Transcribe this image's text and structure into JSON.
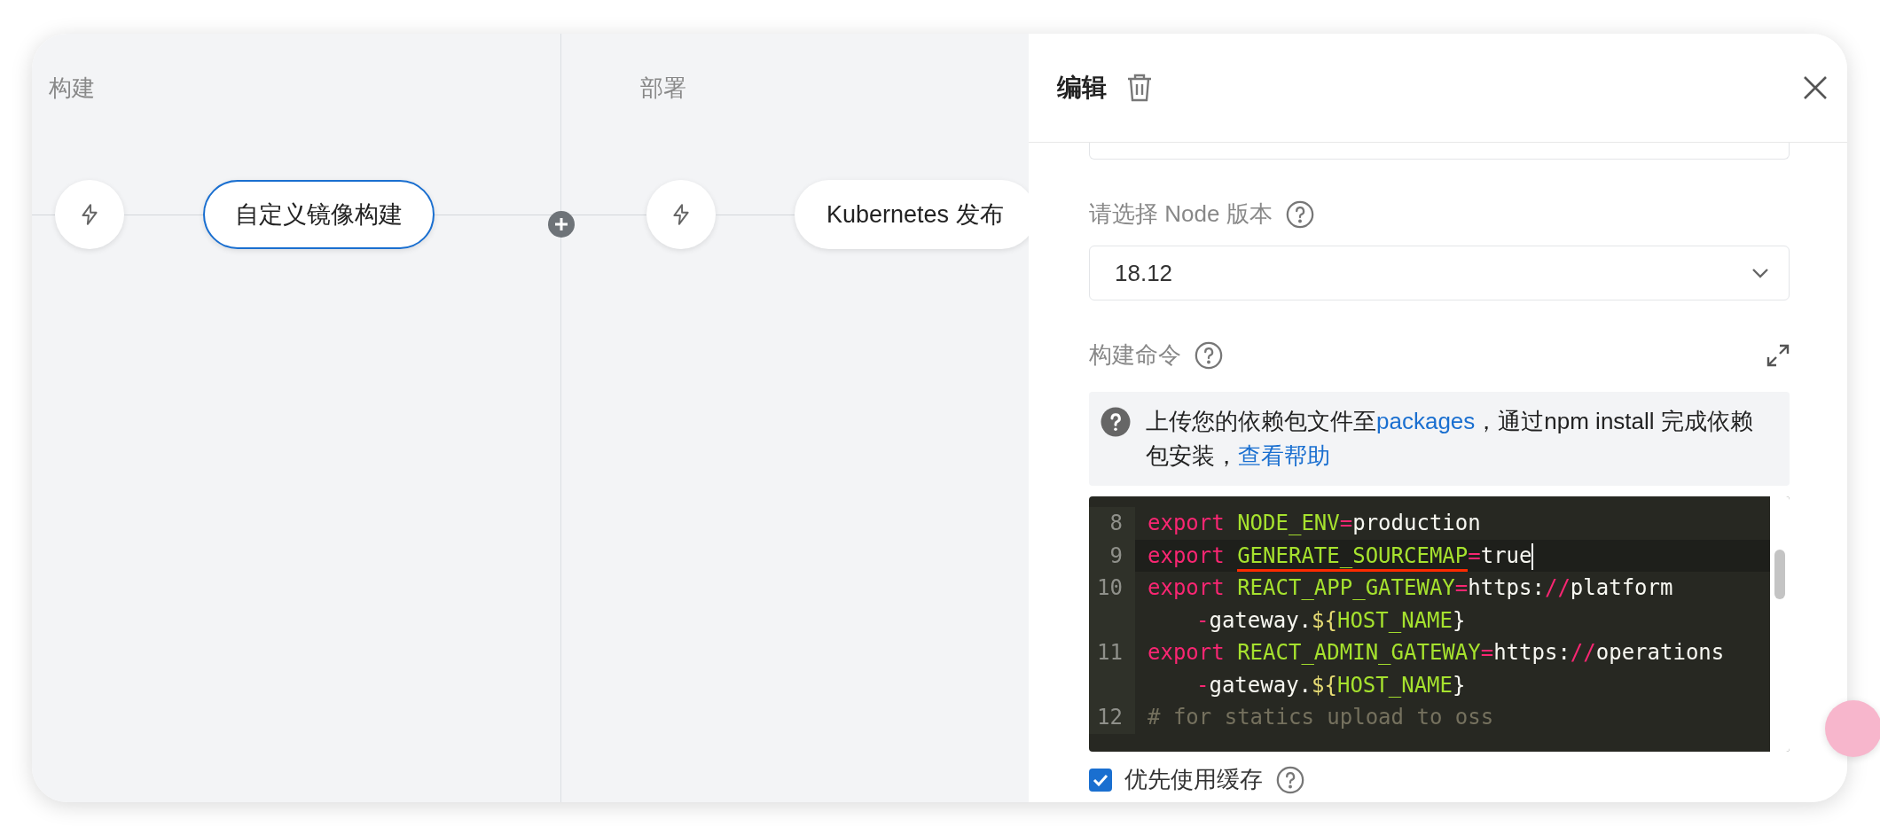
{
  "canvas": {
    "stages": [
      {
        "title": "构建",
        "nodes": [
          {
            "kind": "trigger"
          },
          {
            "kind": "job",
            "label": "自定义镜像构建",
            "selected": true
          }
        ]
      },
      {
        "title": "部署",
        "nodes": [
          {
            "kind": "trigger"
          },
          {
            "kind": "job",
            "label": "Kubernetes 发布",
            "selected": false
          }
        ]
      }
    ]
  },
  "panel": {
    "title": "编辑",
    "node_version": {
      "label": "请选择 Node 版本",
      "value": "18.12"
    },
    "build_command": {
      "label": "构建命令",
      "notice": [
        {
          "text": "上传您的依赖包文件至"
        },
        {
          "text": "packages",
          "link": true
        },
        {
          "text": "，通过npm install 完成依赖包安装，"
        },
        {
          "text": "查看帮助",
          "link": true
        }
      ],
      "code_lines": [
        {
          "number": "8",
          "active": false,
          "tokens": [
            {
              "kind": "keyword",
              "text": "export"
            },
            {
              "kind": "variable",
              "text": "NODE_ENV"
            },
            {
              "kind": "operator",
              "text": "="
            },
            {
              "kind": "text",
              "text": "production"
            }
          ]
        },
        {
          "number": "9",
          "active": true,
          "tokens": [
            {
              "kind": "keyword",
              "text": "export"
            },
            {
              "kind": "variable",
              "text": "GENERATE_SOURCEMAP",
              "underlined": true
            },
            {
              "kind": "operator",
              "text": "="
            },
            {
              "kind": "text",
              "text": "true"
            }
          ]
        },
        {
          "number": "10",
          "active": false,
          "tokens": [
            {
              "kind": "keyword",
              "text": "export"
            },
            {
              "kind": "variable",
              "text": "REACT_APP_GATEWAY"
            },
            {
              "kind": "operator",
              "text": "="
            },
            {
              "kind": "text",
              "text": "https:"
            },
            {
              "kind": "operator",
              "text": "//"
            },
            {
              "kind": "text",
              "text": "platform"
            }
          ],
          "continuation": {
            "tokens": [
              {
                "kind": "operator",
                "text": "-"
              },
              {
                "kind": "text",
                "text": "gateway."
              },
              {
                "kind": "interp",
                "text": "${"
              },
              {
                "kind": "variable",
                "text": "HOST_NAME"
              },
              {
                "kind": "text",
                "text": "}"
              }
            ]
          }
        },
        {
          "number": "11",
          "active": false,
          "tokens": [
            {
              "kind": "keyword",
              "text": "export"
            },
            {
              "kind": "variable",
              "text": "REACT_ADMIN_GATEWAY"
            },
            {
              "kind": "operator",
              "text": "="
            },
            {
              "kind": "text",
              "text": "https:"
            },
            {
              "kind": "operator",
              "text": "//"
            },
            {
              "kind": "text",
              "text": "operations"
            }
          ],
          "continuation": {
            "tokens": [
              {
                "kind": "operator",
                "text": "-"
              },
              {
                "kind": "text",
                "text": "gateway."
              },
              {
                "kind": "interp",
                "text": "${"
              },
              {
                "kind": "variable",
                "text": "HOST_NAME"
              },
              {
                "kind": "text",
                "text": "}"
              }
            ]
          }
        },
        {
          "number": "12",
          "active": false,
          "tokens": [
            {
              "kind": "comment",
              "text": "# for statics upload to oss"
            }
          ]
        }
      ]
    },
    "use_cache": {
      "label": "优先使用缓存",
      "checked": true
    }
  }
}
